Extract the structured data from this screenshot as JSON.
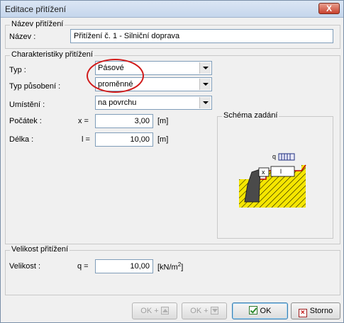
{
  "window": {
    "title": "Editace přitížení",
    "close_label": "X"
  },
  "nazev_group": {
    "legend": "Název přitížení",
    "label": "Název :",
    "value": "Přitížení č. 1 - Silniční doprava"
  },
  "char_group": {
    "legend": "Charakteristiky přitížení",
    "typ_label": "Typ :",
    "typ_value": "Pásové",
    "typ_pusobeni_label": "Typ působení :",
    "typ_pusobeni_value": "proměnné",
    "umisteni_label": "Umístění :",
    "umisteni_value": "na povrchu",
    "pocatek_label": "Počátek :",
    "pocatek_symbol": "x =",
    "pocatek_value": "3,00",
    "pocatek_unit": "[m]",
    "delka_label": "Délka :",
    "delka_symbol": "l =",
    "delka_value": "10,00",
    "delka_unit": "[m]",
    "schema_legend": "Schéma zadání",
    "schema_q": "q",
    "schema_x": "x",
    "schema_l": "l"
  },
  "velikost_group": {
    "legend": "Velikost přitížení",
    "label": "Velikost :",
    "symbol": "q =",
    "value": "10,00",
    "unit_base": "[kN/m",
    "unit_exp": "2",
    "unit_close": "]"
  },
  "buttons": {
    "ok_up": "OK +",
    "ok_down": "OK +",
    "ok": "OK",
    "storno": "Storno"
  },
  "colors": {
    "annotation": "#d01a1a",
    "hatch": "#f5e600",
    "soil_line": "#c00000"
  }
}
